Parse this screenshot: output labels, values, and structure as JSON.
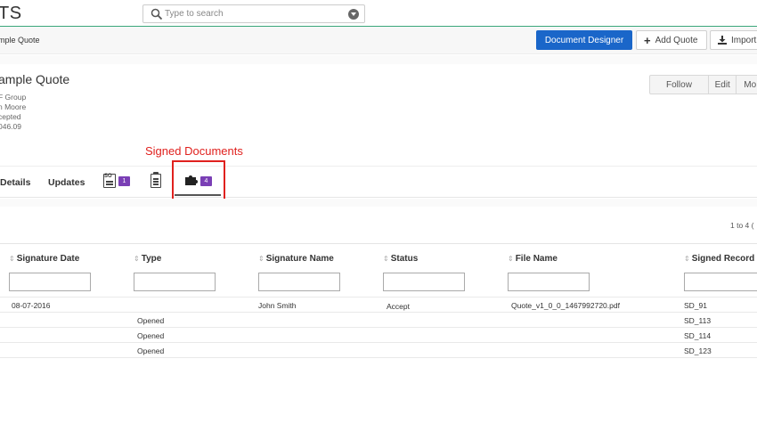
{
  "app": {
    "logo": "TS"
  },
  "search": {
    "placeholder": "Type to search"
  },
  "breadcrumb": {
    "text": "mple Quote"
  },
  "toolbar": {
    "document_designer": "Document Designer",
    "add_quote": "Add Quote",
    "import": "Import"
  },
  "record": {
    "title": "ample Quote",
    "lines": [
      "F Group",
      "n Moore",
      "cepted",
      "046.09"
    ]
  },
  "actions": {
    "follow": "Follow",
    "edit": "Edit",
    "more": "Mo"
  },
  "annotation": {
    "signed_documents": "Signed Documents"
  },
  "tabs": {
    "details": "Details",
    "updates": "Updates",
    "so_badge": "1",
    "sd_badge": "4"
  },
  "colors": {
    "primary": "#1a66c9",
    "badge": "#7a3fb5",
    "highlight": "#e0211e",
    "topline": "#3aa77a"
  },
  "pager": {
    "text": "1 to 4  ("
  },
  "table": {
    "columns": [
      "Signature Date",
      "Type",
      "Signature Name",
      "Status",
      "File Name",
      "Signed Record N"
    ],
    "rows": [
      {
        "date": "08-07-2016",
        "type": "",
        "name": "John Smith",
        "status": "Accept",
        "file": "Quote_v1_0_0_1467992720.pdf",
        "record": "SD_91"
      },
      {
        "date": "",
        "type": "Opened",
        "name": "",
        "status": "",
        "file": "",
        "record": "SD_113"
      },
      {
        "date": "",
        "type": "Opened",
        "name": "",
        "status": "",
        "file": "",
        "record": "SD_114"
      },
      {
        "date": "",
        "type": "Opened",
        "name": "",
        "status": "",
        "file": "",
        "record": "SD_123"
      }
    ]
  }
}
